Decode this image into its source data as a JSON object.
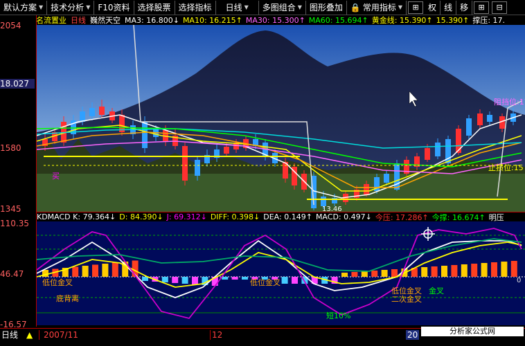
{
  "toolbar": {
    "items": [
      {
        "label": "默认方案",
        "dropdown": true
      },
      {
        "label": "技术分析",
        "dropdown": true
      },
      {
        "label": "F10资料",
        "dropdown": false
      },
      {
        "label": "选择股票",
        "dropdown": false
      },
      {
        "label": "选择指标",
        "dropdown": false
      },
      {
        "label": "日线",
        "dropdown": true
      },
      {
        "label": "多图组合",
        "dropdown": true
      },
      {
        "label": "图形叠加",
        "dropdown": false
      },
      {
        "label": "常用指标",
        "dropdown": true
      }
    ],
    "icon_buttons": [
      "权",
      "线",
      "移"
    ]
  },
  "stock": {
    "name": "名流置业",
    "period": "日线",
    "wallpaper_title": "巍然天空"
  },
  "ma_bar": [
    {
      "label": "MA3: 16.800",
      "dir": "↓",
      "color": "#ffffff"
    },
    {
      "label": "MA10: 16.215",
      "dir": "↑",
      "color": "#ffff00"
    },
    {
      "label": "MA30: 15.300",
      "dir": "↑",
      "color": "#ff66ff"
    },
    {
      "label": "MA60: 15.694",
      "dir": "↑",
      "color": "#00ff00"
    },
    {
      "label": "黄金线: 15.390",
      "dir": "↑",
      "color": "#ffff00"
    },
    {
      "label": "15.390",
      "dir": "↑",
      "color": "#ffff00"
    },
    {
      "label": "撑压: 17.",
      "dir": "",
      "color": "#ffffff"
    }
  ],
  "price_axis": {
    "top": "2054",
    "upper": "18.027",
    "mid": "1580",
    "low": "1345"
  },
  "sub_axis": {
    "top": "110.35",
    "mid": "46.47",
    "low": "-16.57",
    "right_zero": "0"
  },
  "main_labels": {
    "resistance": "阻挡位:17",
    "support": "止损位:15",
    "low_label": "13.46",
    "left_mark": "买"
  },
  "sub_info": [
    {
      "label": "KDMACD K: 79.364",
      "dir": "↓",
      "color": "#ffffff"
    },
    {
      "label": "D: 84.390",
      "dir": "↓",
      "color": "#ffff00"
    },
    {
      "label": "J: 69.312",
      "dir": "↓",
      "color": "#ff00ff"
    },
    {
      "label": "DIFF: 0.398",
      "dir": "↓",
      "color": "#ffff00"
    },
    {
      "label": "DEA: 0.149",
      "dir": "↑",
      "color": "#ffffff"
    },
    {
      "label": "MACD: 0.497",
      "dir": "↓",
      "color": "#ffffff"
    },
    {
      "label": "今压: 17.286",
      "dir": "↑",
      "color": "#ff3333"
    },
    {
      "label": "今撑: 16.674",
      "dir": "↑",
      "color": "#00ff00"
    },
    {
      "label": "明压",
      "dir": "",
      "color": "#ffffff"
    }
  ],
  "sub_labels": {
    "cross1": "低位金叉",
    "divergence": "底背离",
    "cross2": "低位金叉",
    "cross3": "低位金叉",
    "second_cross": "二次金叉",
    "gold_cross": "金叉",
    "pct": "短10%"
  },
  "bottom": {
    "period": "日线",
    "date1": "2007/11",
    "date2": "12",
    "date3": "20"
  },
  "watermark": "分析家公式网www.88gs.com",
  "colors": {
    "up": "#ff3030",
    "down": "#30a0ff",
    "axis": "#b00000",
    "sub_bg": "#000a5a"
  }
}
